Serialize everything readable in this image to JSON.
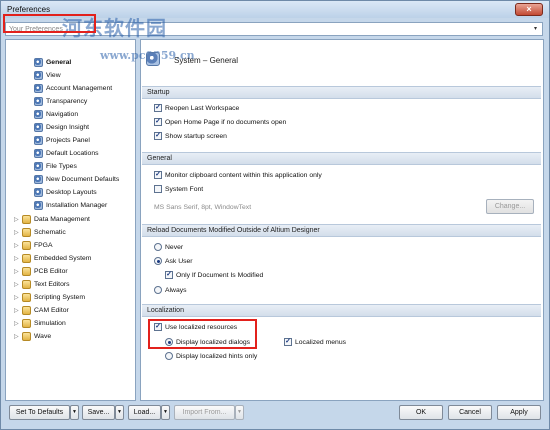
{
  "window": {
    "title": "Preferences",
    "close_glyph": "×"
  },
  "watermark": {
    "text": "河东软件园",
    "url": "www.pc0359.cn"
  },
  "search": {
    "value": "Your Preferences",
    "arrow": "▾"
  },
  "tree": {
    "leaves": [
      "General",
      "View",
      "Account Management",
      "Transparency",
      "Navigation",
      "Design Insight",
      "Projects Panel",
      "Default Locations",
      "File Types",
      "New Document Defaults",
      "Desktop Layouts",
      "Installation Manager"
    ],
    "folders": [
      "Data Management",
      "Schematic",
      "FPGA",
      "Embedded System",
      "PCB Editor",
      "Text Editors",
      "Scripting System",
      "CAM Editor",
      "Simulation",
      "Wave"
    ],
    "expander": "▷"
  },
  "page": {
    "header": "System – General"
  },
  "startup": {
    "title": "Startup",
    "reopen": "Reopen Last Workspace",
    "open_home": "Open Home Page if no documents open",
    "show_splash": "Show startup screen"
  },
  "general": {
    "title": "General",
    "monitor": "Monitor clipboard content within this application only",
    "system_font": "System Font",
    "font_value": "MS Sans Serif, 8pt, WindowText",
    "change_label": "Change..."
  },
  "reload": {
    "title": "Reload Documents Modified Outside of Altium Designer",
    "never": "Never",
    "ask": "Ask User",
    "only_if": "Only If Document Is Modified",
    "always": "Always"
  },
  "localization": {
    "title": "Localization",
    "use_localized": "Use localized resources",
    "display_dialogs": "Display localized dialogs",
    "localized_menus": "Localized menus",
    "display_hints": "Display localized hints only"
  },
  "check_glyph": "✓",
  "footer": {
    "set_defaults": "Set To Defaults",
    "save": "Save...",
    "load": "Load...",
    "import_from": "Import From...",
    "ok": "OK",
    "cancel": "Cancel",
    "apply": "Apply",
    "drop_glyph": "▼"
  }
}
